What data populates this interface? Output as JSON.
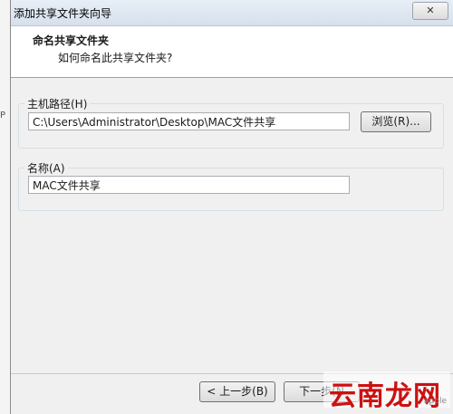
{
  "window": {
    "title": "添加共享文件夹向导",
    "close_glyph": "✕"
  },
  "header": {
    "title": "命名共享文件夹",
    "subtitle": "如何命名此共享文件夹?"
  },
  "host_path": {
    "label": "主机路径(H)",
    "value": "C:\\Users\\Administrator\\Desktop\\MAC文件共享",
    "browse_label": "浏览(R)..."
  },
  "name": {
    "label": "名称(A)",
    "value": "MAC文件共享"
  },
  "footer": {
    "back_label": "< 上一步(B)",
    "next_label": "下一步(N"
  },
  "watermark": {
    "text": "云南龙网",
    "small": "apple"
  },
  "background": {
    "mark": "P"
  }
}
